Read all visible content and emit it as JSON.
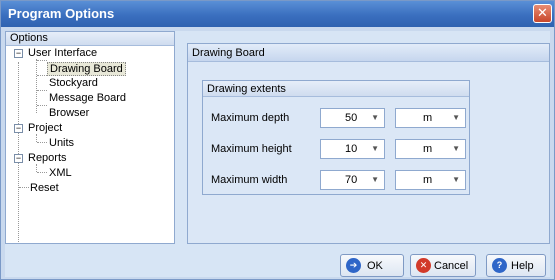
{
  "window": {
    "title": "Program Options",
    "close_symbol": "✕"
  },
  "options_panel": {
    "header": "Options",
    "tree": {
      "user_interface": "User Interface",
      "drawing_board": "Drawing Board",
      "stockyard": "Stockyard",
      "message_board": "Message Board",
      "browser": "Browser",
      "project": "Project",
      "units": "Units",
      "reports": "Reports",
      "xml": "XML",
      "reset": "Reset"
    }
  },
  "main_panel": {
    "header": "Drawing Board",
    "group_title": "Drawing extents",
    "fields": [
      {
        "label": "Maximum depth",
        "value": "50",
        "unit": "m"
      },
      {
        "label": "Maximum height",
        "value": "10",
        "unit": "m"
      },
      {
        "label": "Maximum width",
        "value": "70",
        "unit": "m"
      }
    ]
  },
  "buttons": {
    "ok": "OK",
    "cancel": "Cancel",
    "help": "Help"
  },
  "colors": {
    "title_bar": "#3a6fbf",
    "accent": "#8fa9cf",
    "background": "#d7e5f5"
  },
  "icons": {
    "close": "close-icon",
    "ok": "ok-icon",
    "cancel": "cancel-icon",
    "help": "help-icon"
  }
}
